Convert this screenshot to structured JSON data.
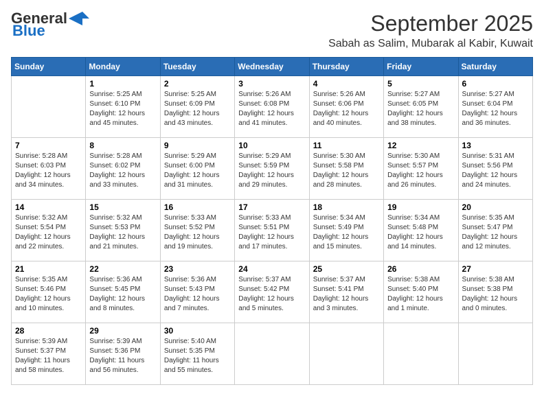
{
  "header": {
    "logo_line1": "General",
    "logo_line2": "Blue",
    "month": "September 2025",
    "location": "Sabah as Salim, Mubarak al Kabir, Kuwait"
  },
  "days_of_week": [
    "Sunday",
    "Monday",
    "Tuesday",
    "Wednesday",
    "Thursday",
    "Friday",
    "Saturday"
  ],
  "weeks": [
    [
      {
        "day": "",
        "info": ""
      },
      {
        "day": "1",
        "info": "Sunrise: 5:25 AM\nSunset: 6:10 PM\nDaylight: 12 hours\nand 45 minutes."
      },
      {
        "day": "2",
        "info": "Sunrise: 5:25 AM\nSunset: 6:09 PM\nDaylight: 12 hours\nand 43 minutes."
      },
      {
        "day": "3",
        "info": "Sunrise: 5:26 AM\nSunset: 6:08 PM\nDaylight: 12 hours\nand 41 minutes."
      },
      {
        "day": "4",
        "info": "Sunrise: 5:26 AM\nSunset: 6:06 PM\nDaylight: 12 hours\nand 40 minutes."
      },
      {
        "day": "5",
        "info": "Sunrise: 5:27 AM\nSunset: 6:05 PM\nDaylight: 12 hours\nand 38 minutes."
      },
      {
        "day": "6",
        "info": "Sunrise: 5:27 AM\nSunset: 6:04 PM\nDaylight: 12 hours\nand 36 minutes."
      }
    ],
    [
      {
        "day": "7",
        "info": "Sunrise: 5:28 AM\nSunset: 6:03 PM\nDaylight: 12 hours\nand 34 minutes."
      },
      {
        "day": "8",
        "info": "Sunrise: 5:28 AM\nSunset: 6:02 PM\nDaylight: 12 hours\nand 33 minutes."
      },
      {
        "day": "9",
        "info": "Sunrise: 5:29 AM\nSunset: 6:00 PM\nDaylight: 12 hours\nand 31 minutes."
      },
      {
        "day": "10",
        "info": "Sunrise: 5:29 AM\nSunset: 5:59 PM\nDaylight: 12 hours\nand 29 minutes."
      },
      {
        "day": "11",
        "info": "Sunrise: 5:30 AM\nSunset: 5:58 PM\nDaylight: 12 hours\nand 28 minutes."
      },
      {
        "day": "12",
        "info": "Sunrise: 5:30 AM\nSunset: 5:57 PM\nDaylight: 12 hours\nand 26 minutes."
      },
      {
        "day": "13",
        "info": "Sunrise: 5:31 AM\nSunset: 5:56 PM\nDaylight: 12 hours\nand 24 minutes."
      }
    ],
    [
      {
        "day": "14",
        "info": "Sunrise: 5:32 AM\nSunset: 5:54 PM\nDaylight: 12 hours\nand 22 minutes."
      },
      {
        "day": "15",
        "info": "Sunrise: 5:32 AM\nSunset: 5:53 PM\nDaylight: 12 hours\nand 21 minutes."
      },
      {
        "day": "16",
        "info": "Sunrise: 5:33 AM\nSunset: 5:52 PM\nDaylight: 12 hours\nand 19 minutes."
      },
      {
        "day": "17",
        "info": "Sunrise: 5:33 AM\nSunset: 5:51 PM\nDaylight: 12 hours\nand 17 minutes."
      },
      {
        "day": "18",
        "info": "Sunrise: 5:34 AM\nSunset: 5:49 PM\nDaylight: 12 hours\nand 15 minutes."
      },
      {
        "day": "19",
        "info": "Sunrise: 5:34 AM\nSunset: 5:48 PM\nDaylight: 12 hours\nand 14 minutes."
      },
      {
        "day": "20",
        "info": "Sunrise: 5:35 AM\nSunset: 5:47 PM\nDaylight: 12 hours\nand 12 minutes."
      }
    ],
    [
      {
        "day": "21",
        "info": "Sunrise: 5:35 AM\nSunset: 5:46 PM\nDaylight: 12 hours\nand 10 minutes."
      },
      {
        "day": "22",
        "info": "Sunrise: 5:36 AM\nSunset: 5:45 PM\nDaylight: 12 hours\nand 8 minutes."
      },
      {
        "day": "23",
        "info": "Sunrise: 5:36 AM\nSunset: 5:43 PM\nDaylight: 12 hours\nand 7 minutes."
      },
      {
        "day": "24",
        "info": "Sunrise: 5:37 AM\nSunset: 5:42 PM\nDaylight: 12 hours\nand 5 minutes."
      },
      {
        "day": "25",
        "info": "Sunrise: 5:37 AM\nSunset: 5:41 PM\nDaylight: 12 hours\nand 3 minutes."
      },
      {
        "day": "26",
        "info": "Sunrise: 5:38 AM\nSunset: 5:40 PM\nDaylight: 12 hours\nand 1 minute."
      },
      {
        "day": "27",
        "info": "Sunrise: 5:38 AM\nSunset: 5:38 PM\nDaylight: 12 hours\nand 0 minutes."
      }
    ],
    [
      {
        "day": "28",
        "info": "Sunrise: 5:39 AM\nSunset: 5:37 PM\nDaylight: 11 hours\nand 58 minutes."
      },
      {
        "day": "29",
        "info": "Sunrise: 5:39 AM\nSunset: 5:36 PM\nDaylight: 11 hours\nand 56 minutes."
      },
      {
        "day": "30",
        "info": "Sunrise: 5:40 AM\nSunset: 5:35 PM\nDaylight: 11 hours\nand 55 minutes."
      },
      {
        "day": "",
        "info": ""
      },
      {
        "day": "",
        "info": ""
      },
      {
        "day": "",
        "info": ""
      },
      {
        "day": "",
        "info": ""
      }
    ]
  ]
}
